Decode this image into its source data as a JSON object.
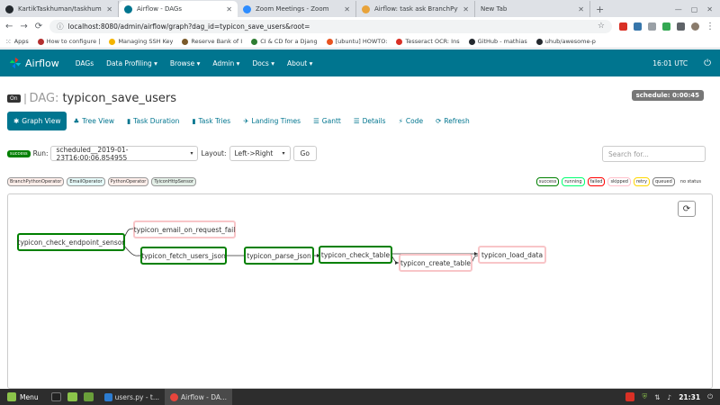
{
  "browser": {
    "tabs": [
      {
        "title": "KartikTaskhuman/taskhuma",
        "active": false,
        "fav_color": "#24292e"
      },
      {
        "title": "Airflow - DAGs",
        "active": true,
        "fav_color": "#00758f"
      },
      {
        "title": "Zoom Meetings - Zoom",
        "active": false,
        "fav_color": "#2d8cff"
      },
      {
        "title": "Airflow: task ask BranchPytho",
        "active": false,
        "fav_color": "#e8a33a"
      },
      {
        "title": "New Tab",
        "active": false,
        "fav_color": "#dee1e6"
      }
    ],
    "new_tab_symbol": "+",
    "url": "localhost:8080/admin/airflow/graph?dag_id=typicon_save_users&root=",
    "bookmarks": [
      {
        "label": "Apps",
        "color": "#5f6368"
      },
      {
        "label": "How to configure |",
        "color": "#b32f2f"
      },
      {
        "label": "Managing SSH Key",
        "color": "#f4b400"
      },
      {
        "label": "Reserve Bank of I",
        "color": "#7a5a2a"
      },
      {
        "label": "CI & CD for a Djang",
        "color": "#2e7d32"
      },
      {
        "label": "[ubuntu] HOWTO:",
        "color": "#e95420"
      },
      {
        "label": "Tesseract OCR: Ins",
        "color": "#d93025"
      },
      {
        "label": "GitHub - mathias",
        "color": "#24292e"
      },
      {
        "label": "uhub/awesome-p",
        "color": "#24292e"
      }
    ]
  },
  "airflow_nav": {
    "brand": "Airflow",
    "items": [
      "DAGs",
      "Data Profiling",
      "Browse",
      "Admin",
      "Docs",
      "About"
    ],
    "dropdown_items": [
      "Data Profiling",
      "Browse",
      "Admin",
      "Docs",
      "About"
    ],
    "time": "16:01 UTC"
  },
  "dag": {
    "on_label": "On",
    "dag_word": "DAG:",
    "dag_id": "typicon_save_users",
    "schedule": "schedule: 0:00:45"
  },
  "view_tabs": [
    {
      "label": "Graph View",
      "icon": "asterisk-icon",
      "glyph": "✱",
      "active": true
    },
    {
      "label": "Tree View",
      "icon": "tree-icon",
      "glyph": "♣",
      "active": false
    },
    {
      "label": "Task Duration",
      "icon": "bar-chart-icon",
      "glyph": "▮",
      "active": false
    },
    {
      "label": "Task Tries",
      "icon": "bar-chart-icon",
      "glyph": "▮",
      "active": false
    },
    {
      "label": "Landing Times",
      "icon": "plane-icon",
      "glyph": "✈",
      "active": false
    },
    {
      "label": "Gantt",
      "icon": "list-icon",
      "glyph": "☰",
      "active": false
    },
    {
      "label": "Details",
      "icon": "list-icon",
      "glyph": "☰",
      "active": false
    },
    {
      "label": "Code",
      "icon": "flash-icon",
      "glyph": "⚡",
      "active": false
    },
    {
      "label": "Refresh",
      "icon": "refresh-icon",
      "glyph": "⟳",
      "active": false
    }
  ],
  "run_controls": {
    "state_badge": "success",
    "run_label": "Run:",
    "run_value": "scheduled__2019-01-23T16:00:06.854955",
    "layout_label": "Layout:",
    "layout_value": "Left->Right",
    "go_label": "Go",
    "search_placeholder": "Search for..."
  },
  "operator_legend": [
    {
      "label": "BranchPythonOperator",
      "color": "#ffefeb"
    },
    {
      "label": "EmailOperator",
      "color": "#e6faf9"
    },
    {
      "label": "PythonOperator",
      "color": "#ffefeb"
    },
    {
      "label": "TyiconHttpSensor",
      "color": "#e4f0e8"
    }
  ],
  "status_legend": [
    "success",
    "running",
    "failed",
    "skipped",
    "retry",
    "queued",
    "no status"
  ],
  "graph": {
    "tasks": [
      {
        "id": "typicon_check_endpoint_sensor",
        "state": "success"
      },
      {
        "id": "typicon_email_on_request_fail",
        "state": "no status"
      },
      {
        "id": "typicon_fetch_users_json",
        "state": "success"
      },
      {
        "id": "typicon_parse_json",
        "state": "success"
      },
      {
        "id": "typicon_check_table",
        "state": "success"
      },
      {
        "id": "typicon_create_table",
        "state": "no status"
      },
      {
        "id": "typicon_load_data",
        "state": "no status"
      }
    ]
  },
  "taskbar": {
    "menu_label": "Menu",
    "windows": [
      {
        "label": "users.py - t...",
        "active": false
      },
      {
        "label": "Airflow - DA...",
        "active": true
      }
    ],
    "clock": "21:31"
  }
}
